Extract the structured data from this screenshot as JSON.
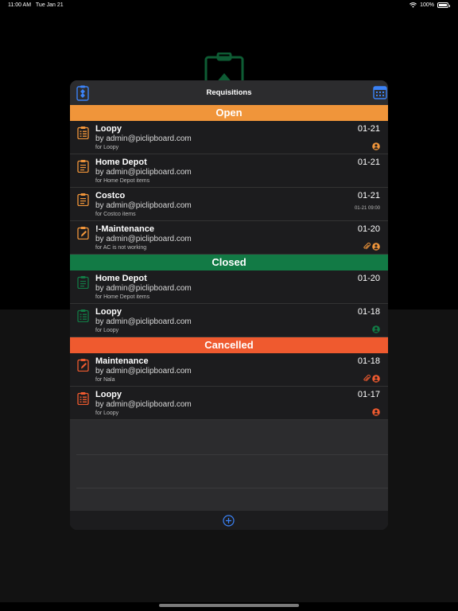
{
  "status_bar": {
    "time": "11:00 AM",
    "date": "Tue Jan 21",
    "battery": "100%"
  },
  "modal": {
    "title": "Requisitions"
  },
  "colors": {
    "open": "#f0953a",
    "closed": "#127a45",
    "cancelled": "#ef5a2f",
    "accent_blue": "#3b82f6"
  },
  "sections": [
    {
      "label": "Open",
      "items": [
        {
          "icon": "list-clipboard-icon",
          "title": "Loopy",
          "by": "by admin@piclipboard.com",
          "for": "for Loopy",
          "date": "01-21",
          "subdate": "",
          "badges": [
            "person-icon"
          ]
        },
        {
          "icon": "clipboard-icon",
          "title": "Home Depot",
          "by": "by admin@piclipboard.com",
          "for": "for Home Depot items",
          "date": "01-21",
          "subdate": "",
          "badges": []
        },
        {
          "icon": "clipboard-icon",
          "title": "Costco",
          "by": "by admin@piclipboard.com",
          "for": "for Costco items",
          "date": "01-21",
          "subdate": "01-21 09:00",
          "badges": []
        },
        {
          "icon": "edit-clipboard-icon",
          "title": "!-Maintenance",
          "by": "by admin@piclipboard.com",
          "for": "for AC is not working",
          "date": "01-20",
          "subdate": "",
          "badges": [
            "paperclip-icon",
            "person-icon"
          ]
        }
      ]
    },
    {
      "label": "Closed",
      "items": [
        {
          "icon": "clipboard-icon",
          "title": "Home Depot",
          "by": "by admin@piclipboard.com",
          "for": "for Home Depot items",
          "date": "01-20",
          "subdate": "",
          "badges": []
        },
        {
          "icon": "list-clipboard-icon",
          "title": "Loopy",
          "by": "by admin@piclipboard.com",
          "for": "for Loopy",
          "date": "01-18",
          "subdate": "",
          "badges": [
            "person-icon"
          ]
        }
      ]
    },
    {
      "label": "Cancelled",
      "items": [
        {
          "icon": "edit-clipboard-icon",
          "title": "Maintenance",
          "by": "by admin@piclipboard.com",
          "for": "for Nala",
          "date": "01-18",
          "subdate": "",
          "badges": [
            "paperclip-icon",
            "person-icon"
          ]
        },
        {
          "icon": "list-clipboard-icon",
          "title": "Loopy",
          "by": "by admin@piclipboard.com",
          "for": "for Loopy",
          "date": "01-17",
          "subdate": "",
          "badges": [
            "person-icon"
          ]
        }
      ]
    }
  ]
}
